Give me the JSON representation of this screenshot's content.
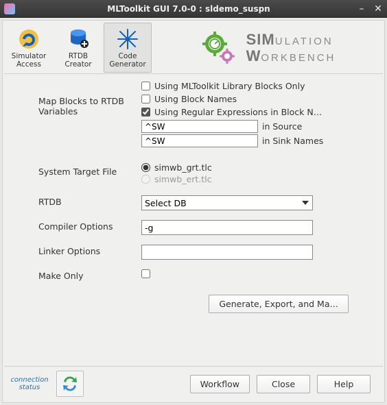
{
  "window": {
    "title": "MLToolkit GUI 7.0-0 : sldemo_suspn"
  },
  "toolbar": {
    "items": [
      {
        "label1": "Simulator",
        "label2": "Access"
      },
      {
        "label1": "RTDB",
        "label2": "Creator"
      },
      {
        "label1": "Code",
        "label2": "Generator"
      }
    ],
    "active_index": 2,
    "logo": {
      "line1_big": "SIM",
      "line1_small": "ULATION",
      "line2_big": "W",
      "line2_small": "ORKBENCH"
    }
  },
  "form": {
    "map_label": "Map Blocks to RTDB Variables",
    "checks": {
      "lib_only": {
        "label": "Using MLToolkit Library Blocks Only",
        "checked": false
      },
      "block_names": {
        "label": "Using Block Names",
        "checked": false
      },
      "regex": {
        "label": "Using Regular Expressions in Block N…",
        "checked": true
      }
    },
    "regex_source": {
      "value": "^SW",
      "suffix": "in Source"
    },
    "regex_sink": {
      "value": "^SW",
      "suffix": "in Sink Names"
    },
    "target_label": "System Target File",
    "target_radios": {
      "grt": {
        "label": "simwb_grt.tlc",
        "checked": true
      },
      "ert": {
        "label": "simwb_ert.tlc",
        "checked": false,
        "disabled": true
      }
    },
    "rtdb_label": "RTDB",
    "rtdb_value": "Select DB",
    "compiler_label": "Compiler Options",
    "compiler_value": "-g",
    "linker_label": "Linker Options",
    "linker_value": "",
    "makeonly_label": "Make Only",
    "makeonly_checked": false,
    "generate_btn": "Generate, Export, and Ma…"
  },
  "bottom": {
    "conn_status": "connection status",
    "workflow": "Workflow",
    "close": "Close",
    "help": "Help"
  }
}
